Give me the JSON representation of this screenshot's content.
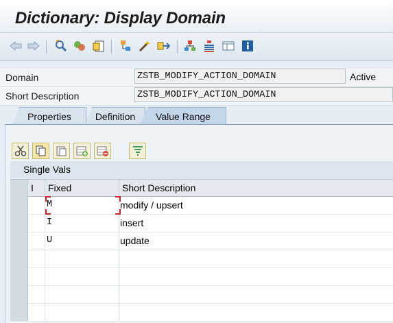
{
  "window": {
    "title": "Dictionary: Display Domain"
  },
  "toolbar": {
    "icons": [
      "back-icon",
      "forward-icon",
      "other-object-icon",
      "display-change-icon",
      "object-switch-icon",
      "hierarchy-icon",
      "activate-icon",
      "where-used-icon",
      "object-list-icon",
      "display-object-list-icon",
      "navigation-window-icon",
      "info-icon"
    ]
  },
  "header": {
    "domain_label": "Domain",
    "domain_value": "ZSTB_MODIFY_ACTION_DOMAIN",
    "status": "Active",
    "short_desc_label": "Short Description",
    "short_desc_value": "ZSTB_MODIFY_ACTION_DOMAIN"
  },
  "tabs": [
    {
      "label": "Properties",
      "active": false
    },
    {
      "label": "Definition",
      "active": false
    },
    {
      "label": "Value Range",
      "active": true
    }
  ],
  "value_range": {
    "section_title": "Single Vals",
    "columns": {
      "i": "I",
      "fixed": "Fixed",
      "desc": "Short Description"
    },
    "rows": [
      {
        "fixed": "M",
        "desc": "modify / upsert"
      },
      {
        "fixed": "I",
        "desc": "insert"
      },
      {
        "fixed": "U",
        "desc": "update"
      },
      {
        "fixed": "",
        "desc": ""
      },
      {
        "fixed": "",
        "desc": ""
      },
      {
        "fixed": "",
        "desc": ""
      },
      {
        "fixed": "",
        "desc": ""
      }
    ]
  },
  "colors": {
    "accent": "#1f5fa0",
    "tab_active": "#c3d6ea",
    "focus_marker": "#c62828"
  }
}
